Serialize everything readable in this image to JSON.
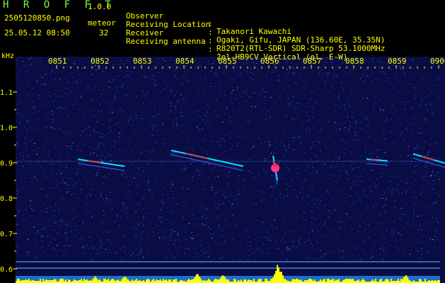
{
  "header": {
    "brand": "H R O F F T",
    "version": "1.0.0",
    "filename": "2505120850.png",
    "detection_label": "meteor",
    "datetime": "25.05.12 08:50",
    "detection_count": "32",
    "info": [
      {
        "label": "Observer",
        "sep": ":",
        "value": "Takanori Kawachi"
      },
      {
        "label": "Receiving Location",
        "sep": ":",
        "value": "Ogaki, Gifu, JAPAN (136.60E, 35.35N)"
      },
      {
        "label": "Receiver",
        "sep": ":",
        "value": "R820T2(RTL-SDR) SDR-Sharp 53.1000MHz"
      },
      {
        "label": "Receiving antenna",
        "sep": ":",
        "value": "2el-HB9CV Vertical (el. E-W)"
      }
    ]
  },
  "colors": {
    "background": "#000000",
    "spectrogram_noise": "#1a1f78",
    "axis_text": "#FFFF00",
    "brand_green": "#7CFC4A",
    "signal_cyan": "#00E5FF",
    "signal_red": "#FF2A2A",
    "signal_magenta": "#FF3399",
    "activity_yellow": "#FFFF00"
  },
  "chart_data": {
    "type": "heatmap",
    "ylabel": "kHz",
    "x_ticks": [
      "0851",
      "0852",
      "0853",
      "0854",
      "0855",
      "0856",
      "0857",
      "0858",
      "0859",
      "0900"
    ],
    "y_ticks": [
      "1.1",
      "1.0",
      "0.9",
      "0.8",
      "0.7",
      "0.6"
    ],
    "y_range": [
      0.58,
      1.2
    ],
    "x_range_minutes": [
      0,
      10
    ],
    "carrier_khz": 0.905,
    "meteor_echoes": [
      {
        "time_min": 0.5,
        "freq_khz": 0.91,
        "end_time_min": 1.6,
        "end_freq_khz": 0.89
      },
      {
        "time_min": 2.7,
        "freq_khz": 0.935,
        "end_time_min": 4.4,
        "end_freq_khz": 0.89
      },
      {
        "time_min": 5.1,
        "freq_khz": 0.92,
        "end_time_min": 5.2,
        "end_freq_khz": 0.85
      },
      {
        "time_min": 7.3,
        "freq_khz": 0.91,
        "end_time_min": 7.8,
        "end_freq_khz": 0.905
      },
      {
        "time_min": 8.4,
        "freq_khz": 0.925,
        "end_time_min": 9.4,
        "end_freq_khz": 0.89
      }
    ],
    "activity_bursts": [
      {
        "time_min": 0.9,
        "level": 0.35
      },
      {
        "time_min": 1.6,
        "level": 0.4
      },
      {
        "time_min": 3.3,
        "level": 0.55
      },
      {
        "time_min": 3.9,
        "level": 0.45
      },
      {
        "time_min": 5.2,
        "level": 1.0
      },
      {
        "time_min": 6.9,
        "level": 0.3
      },
      {
        "time_min": 8.2,
        "level": 0.45
      },
      {
        "time_min": 9.6,
        "level": 0.3
      }
    ]
  }
}
